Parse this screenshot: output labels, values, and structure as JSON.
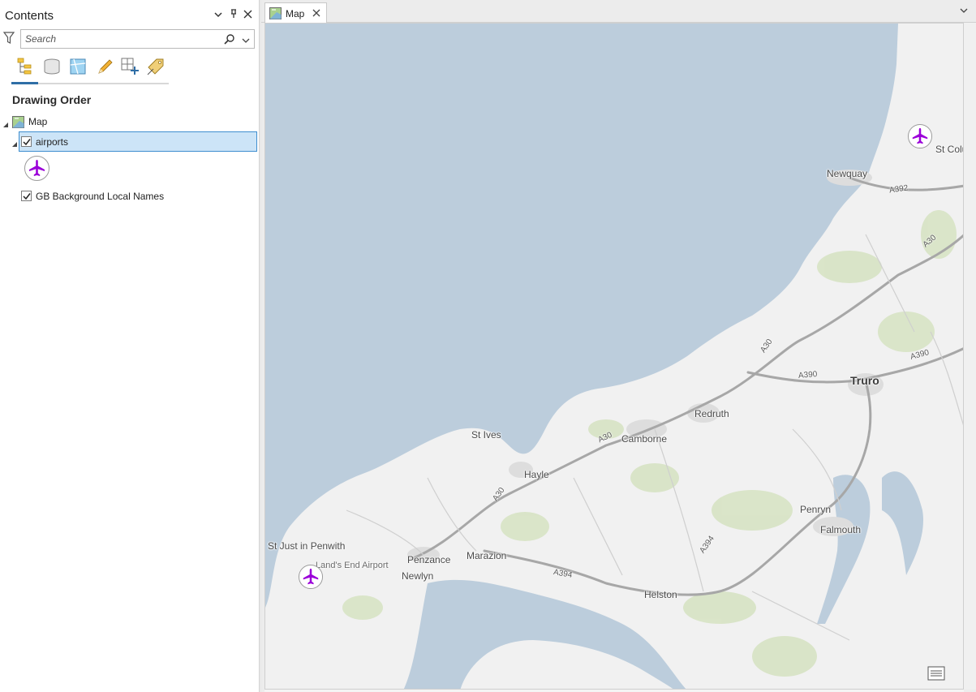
{
  "contents_pane": {
    "title": "Contents",
    "search": {
      "placeholder": "Search",
      "value": ""
    },
    "toolbar_icons": [
      "list-by-drawing-order-icon",
      "list-by-data-source-icon",
      "list-by-selection-icon",
      "list-by-editing-icon",
      "list-by-snapping-icon",
      "list-by-labeling-icon"
    ],
    "section_heading": "Drawing Order",
    "tree": {
      "map": {
        "label": "Map"
      },
      "layers": [
        {
          "label": "airports",
          "checked": true,
          "selected": true,
          "symbol": "airplane-icon"
        },
        {
          "label": "GB Background Local Names",
          "checked": true,
          "selected": false
        }
      ]
    }
  },
  "map_view": {
    "tab_label": "Map",
    "places": [
      {
        "name": "St Colu",
        "size": "normal"
      },
      {
        "name": "Newquay",
        "size": "normal"
      },
      {
        "name": "Truro",
        "size": "big"
      },
      {
        "name": "Redruth",
        "size": "normal"
      },
      {
        "name": "Camborne",
        "size": "normal"
      },
      {
        "name": "St Ives",
        "size": "normal"
      },
      {
        "name": "Hayle",
        "size": "normal"
      },
      {
        "name": "St Just in Penwith",
        "size": "normal"
      },
      {
        "name": "Land's End Airport",
        "size": "small"
      },
      {
        "name": "Penzance",
        "size": "normal"
      },
      {
        "name": "Newlyn",
        "size": "normal"
      },
      {
        "name": "Marazion",
        "size": "normal"
      },
      {
        "name": "Helston",
        "size": "normal"
      },
      {
        "name": "Penryn",
        "size": "normal"
      },
      {
        "name": "Falmouth",
        "size": "normal"
      }
    ],
    "roads": [
      "A392",
      "A30",
      "A30",
      "A390",
      "A390",
      "A30",
      "A30",
      "A394",
      "A394"
    ]
  },
  "colors": {
    "accent": "#2f6ea6",
    "selection_fill": "#cce4f7",
    "sea": "#bccddc",
    "land": "#f1f1f1",
    "airport_symbol": "#9b00d9"
  }
}
